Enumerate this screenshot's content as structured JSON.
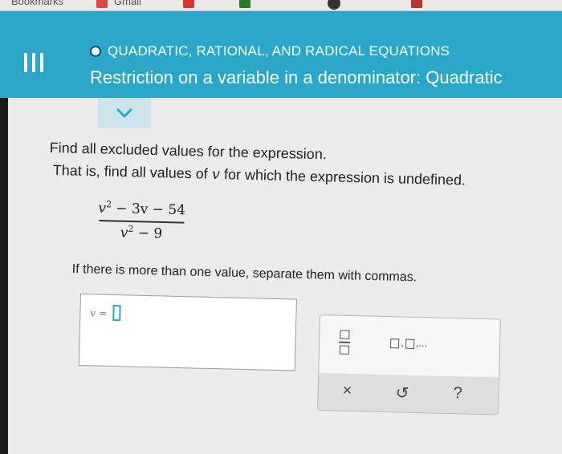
{
  "browser": {
    "bookmarks": [
      "Bookmarks",
      "Gmail"
    ]
  },
  "header": {
    "topic": "QUADRATIC, RATIONAL, AND RADICAL EQUATIONS",
    "title": "Restriction on a variable in a denominator: Quadratic"
  },
  "question": {
    "line1": "Find all excluded values for the expression.",
    "line2_a": "That is, find all values of ",
    "line2_var": "v",
    "line2_b": " for which the expression is undefined.",
    "numerator_base": "v",
    "numerator_exp": "2",
    "numerator_rest": " − 3v − 54",
    "denominator_base": "v",
    "denominator_exp": "2",
    "denominator_rest": " − 9",
    "instruction": "If there is more than one value, separate them with commas."
  },
  "answer": {
    "label": "v ="
  },
  "toolbox": {
    "sequence_dots": ",...",
    "clear_symbol": "×",
    "undo_symbol": "↺",
    "help_symbol": "?"
  },
  "colors": {
    "header_bg": "#2aa6c8",
    "panel_bg": "#ececec"
  }
}
